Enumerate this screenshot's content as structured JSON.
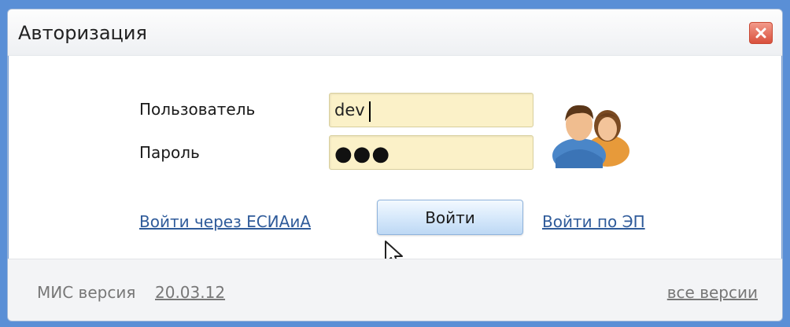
{
  "dialog": {
    "title": "Авторизация",
    "close_icon": "close-icon"
  },
  "form": {
    "user_label": "Пользователь",
    "user_value": "dev",
    "password_label": "Пароль",
    "password_mask": "●●●"
  },
  "actions": {
    "esia_link": "Войти через ЕСИАиА",
    "login_button": "Войти",
    "ep_link": "Войти по ЭП"
  },
  "footer": {
    "version_label": "МИС версия",
    "version_value": "20.03.12",
    "all_versions": "все версии"
  },
  "icons": {
    "users": "users-icon",
    "cursor": "mouse-pointer-icon"
  },
  "colors": {
    "field_bg": "#fbf1c8",
    "link": "#2f5b9a",
    "close": "#d9503c",
    "button": "#d7e9fb"
  }
}
